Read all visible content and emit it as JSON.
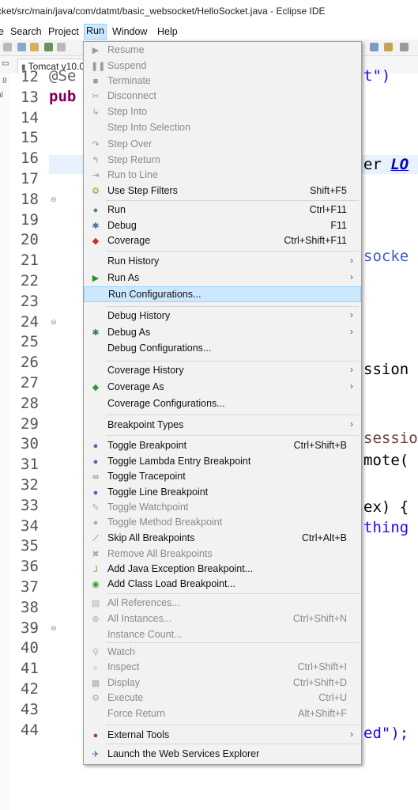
{
  "window": {
    "title": "cket/src/main/java/com/datmt/basic_websocket/HelloSocket.java - Eclipse IDE"
  },
  "menubar": {
    "items": [
      "e",
      "Search",
      "Project",
      "Run",
      "Window",
      "Help"
    ],
    "active": "Run"
  },
  "editor_tab": {
    "label": "Tomcat v10.0"
  },
  "left_strip": {
    "labels": [
      "8",
      "ial"
    ]
  },
  "line_numbers": [
    "12",
    "13",
    "14",
    "15",
    "16",
    "17",
    "18",
    "19",
    "20",
    "21",
    "22",
    "23",
    "24",
    "25",
    "26",
    "27",
    "28",
    "29",
    "30",
    "31",
    "32",
    "33",
    "34",
    "35",
    "36",
    "37",
    "38",
    "39",
    "40",
    "41",
    "42",
    "43",
    "44"
  ],
  "code": {
    "l12_prefix": "@Se",
    "l12_suffix": "t\")",
    "l13_kw": "pub",
    "l16_text": "er ",
    "l16_italic": "LO",
    "l20_text": "socke",
    "l25_text": "ssion",
    "l28_text": "sessio",
    "l29_text": "mote(",
    "l31_text": "ex) {",
    "l32_text": "thing",
    "l41_text": "ed\");"
  },
  "run_menu": {
    "items": [
      {
        "label": "Resume",
        "icon": "resume-icon",
        "disabled": true
      },
      {
        "label": "Suspend",
        "icon": "suspend-icon",
        "disabled": true
      },
      {
        "label": "Terminate",
        "icon": "terminate-icon",
        "disabled": true
      },
      {
        "label": "Disconnect",
        "icon": "disconnect-icon",
        "disabled": true
      },
      {
        "label": "Step Into",
        "icon": "step-into-icon",
        "disabled": true
      },
      {
        "label": "Step Into Selection",
        "disabled": true
      },
      {
        "label": "Step Over",
        "icon": "step-over-icon",
        "disabled": true
      },
      {
        "label": "Step Return",
        "icon": "step-return-icon",
        "disabled": true
      },
      {
        "label": "Run to Line",
        "icon": "run-to-line-icon",
        "disabled": true
      },
      {
        "label": "Use Step Filters",
        "icon": "step-filters-icon",
        "shortcut": "Shift+F5"
      },
      {
        "label": "Run",
        "icon": "run-icon",
        "shortcut": "Ctrl+F11"
      },
      {
        "label": "Debug",
        "icon": "debug-icon",
        "shortcut": "F11"
      },
      {
        "label": "Coverage",
        "icon": "coverage-icon",
        "shortcut": "Ctrl+Shift+F11"
      },
      {
        "label": "Run History",
        "submenu": true
      },
      {
        "label": "Run As",
        "icon": "run-as-icon",
        "submenu": true
      },
      {
        "label": "Run Configurations...",
        "selected": true
      },
      {
        "label": "Debug History",
        "submenu": true
      },
      {
        "label": "Debug As",
        "icon": "debug-as-icon",
        "submenu": true
      },
      {
        "label": "Debug Configurations..."
      },
      {
        "label": "Coverage History",
        "submenu": true
      },
      {
        "label": "Coverage As",
        "icon": "coverage-as-icon",
        "submenu": true
      },
      {
        "label": "Coverage Configurations..."
      },
      {
        "label": "Breakpoint Types",
        "submenu": true
      },
      {
        "label": "Toggle Breakpoint",
        "icon": "breakpoint-icon",
        "shortcut": "Ctrl+Shift+B"
      },
      {
        "label": "Toggle Lambda Entry Breakpoint",
        "icon": "breakpoint-icon"
      },
      {
        "label": "Toggle Tracepoint",
        "icon": "tracepoint-icon"
      },
      {
        "label": "Toggle Line Breakpoint",
        "icon": "breakpoint-icon"
      },
      {
        "label": "Toggle Watchpoint",
        "icon": "watchpoint-icon",
        "disabled": true
      },
      {
        "label": "Toggle Method Breakpoint",
        "icon": "method-breakpoint-icon",
        "disabled": true
      },
      {
        "label": "Skip All Breakpoints",
        "icon": "skip-breakpoints-icon",
        "shortcut": "Ctrl+Alt+B"
      },
      {
        "label": "Remove All Breakpoints",
        "icon": "remove-breakpoints-icon",
        "disabled": true
      },
      {
        "label": "Add Java Exception Breakpoint...",
        "icon": "exception-breakpoint-icon"
      },
      {
        "label": "Add Class Load Breakpoint...",
        "icon": "class-load-breakpoint-icon"
      },
      {
        "label": "All References...",
        "icon": "references-icon",
        "disabled": true
      },
      {
        "label": "All Instances...",
        "icon": "instances-icon",
        "shortcut": "Ctrl+Shift+N",
        "disabled": true
      },
      {
        "label": "Instance Count...",
        "disabled": true
      },
      {
        "label": "Watch",
        "icon": "watch-icon",
        "disabled": true
      },
      {
        "label": "Inspect",
        "icon": "inspect-icon",
        "shortcut": "Ctrl+Shift+I",
        "disabled": true
      },
      {
        "label": "Display",
        "icon": "display-icon",
        "shortcut": "Ctrl+Shift+D",
        "disabled": true
      },
      {
        "label": "Execute",
        "icon": "execute-icon",
        "shortcut": "Ctrl+U",
        "disabled": true
      },
      {
        "label": "Force Return",
        "shortcut": "Alt+Shift+F",
        "disabled": true
      },
      {
        "label": "External Tools",
        "icon": "external-tools-icon",
        "submenu": true
      },
      {
        "label": "Launch the Web Services Explorer",
        "icon": "web-services-icon"
      }
    ]
  },
  "colors": {
    "menu_bg": "#f2f2f2",
    "selection": "#cce8ff",
    "keyword": "#7f0055",
    "string": "#2a00ff"
  }
}
